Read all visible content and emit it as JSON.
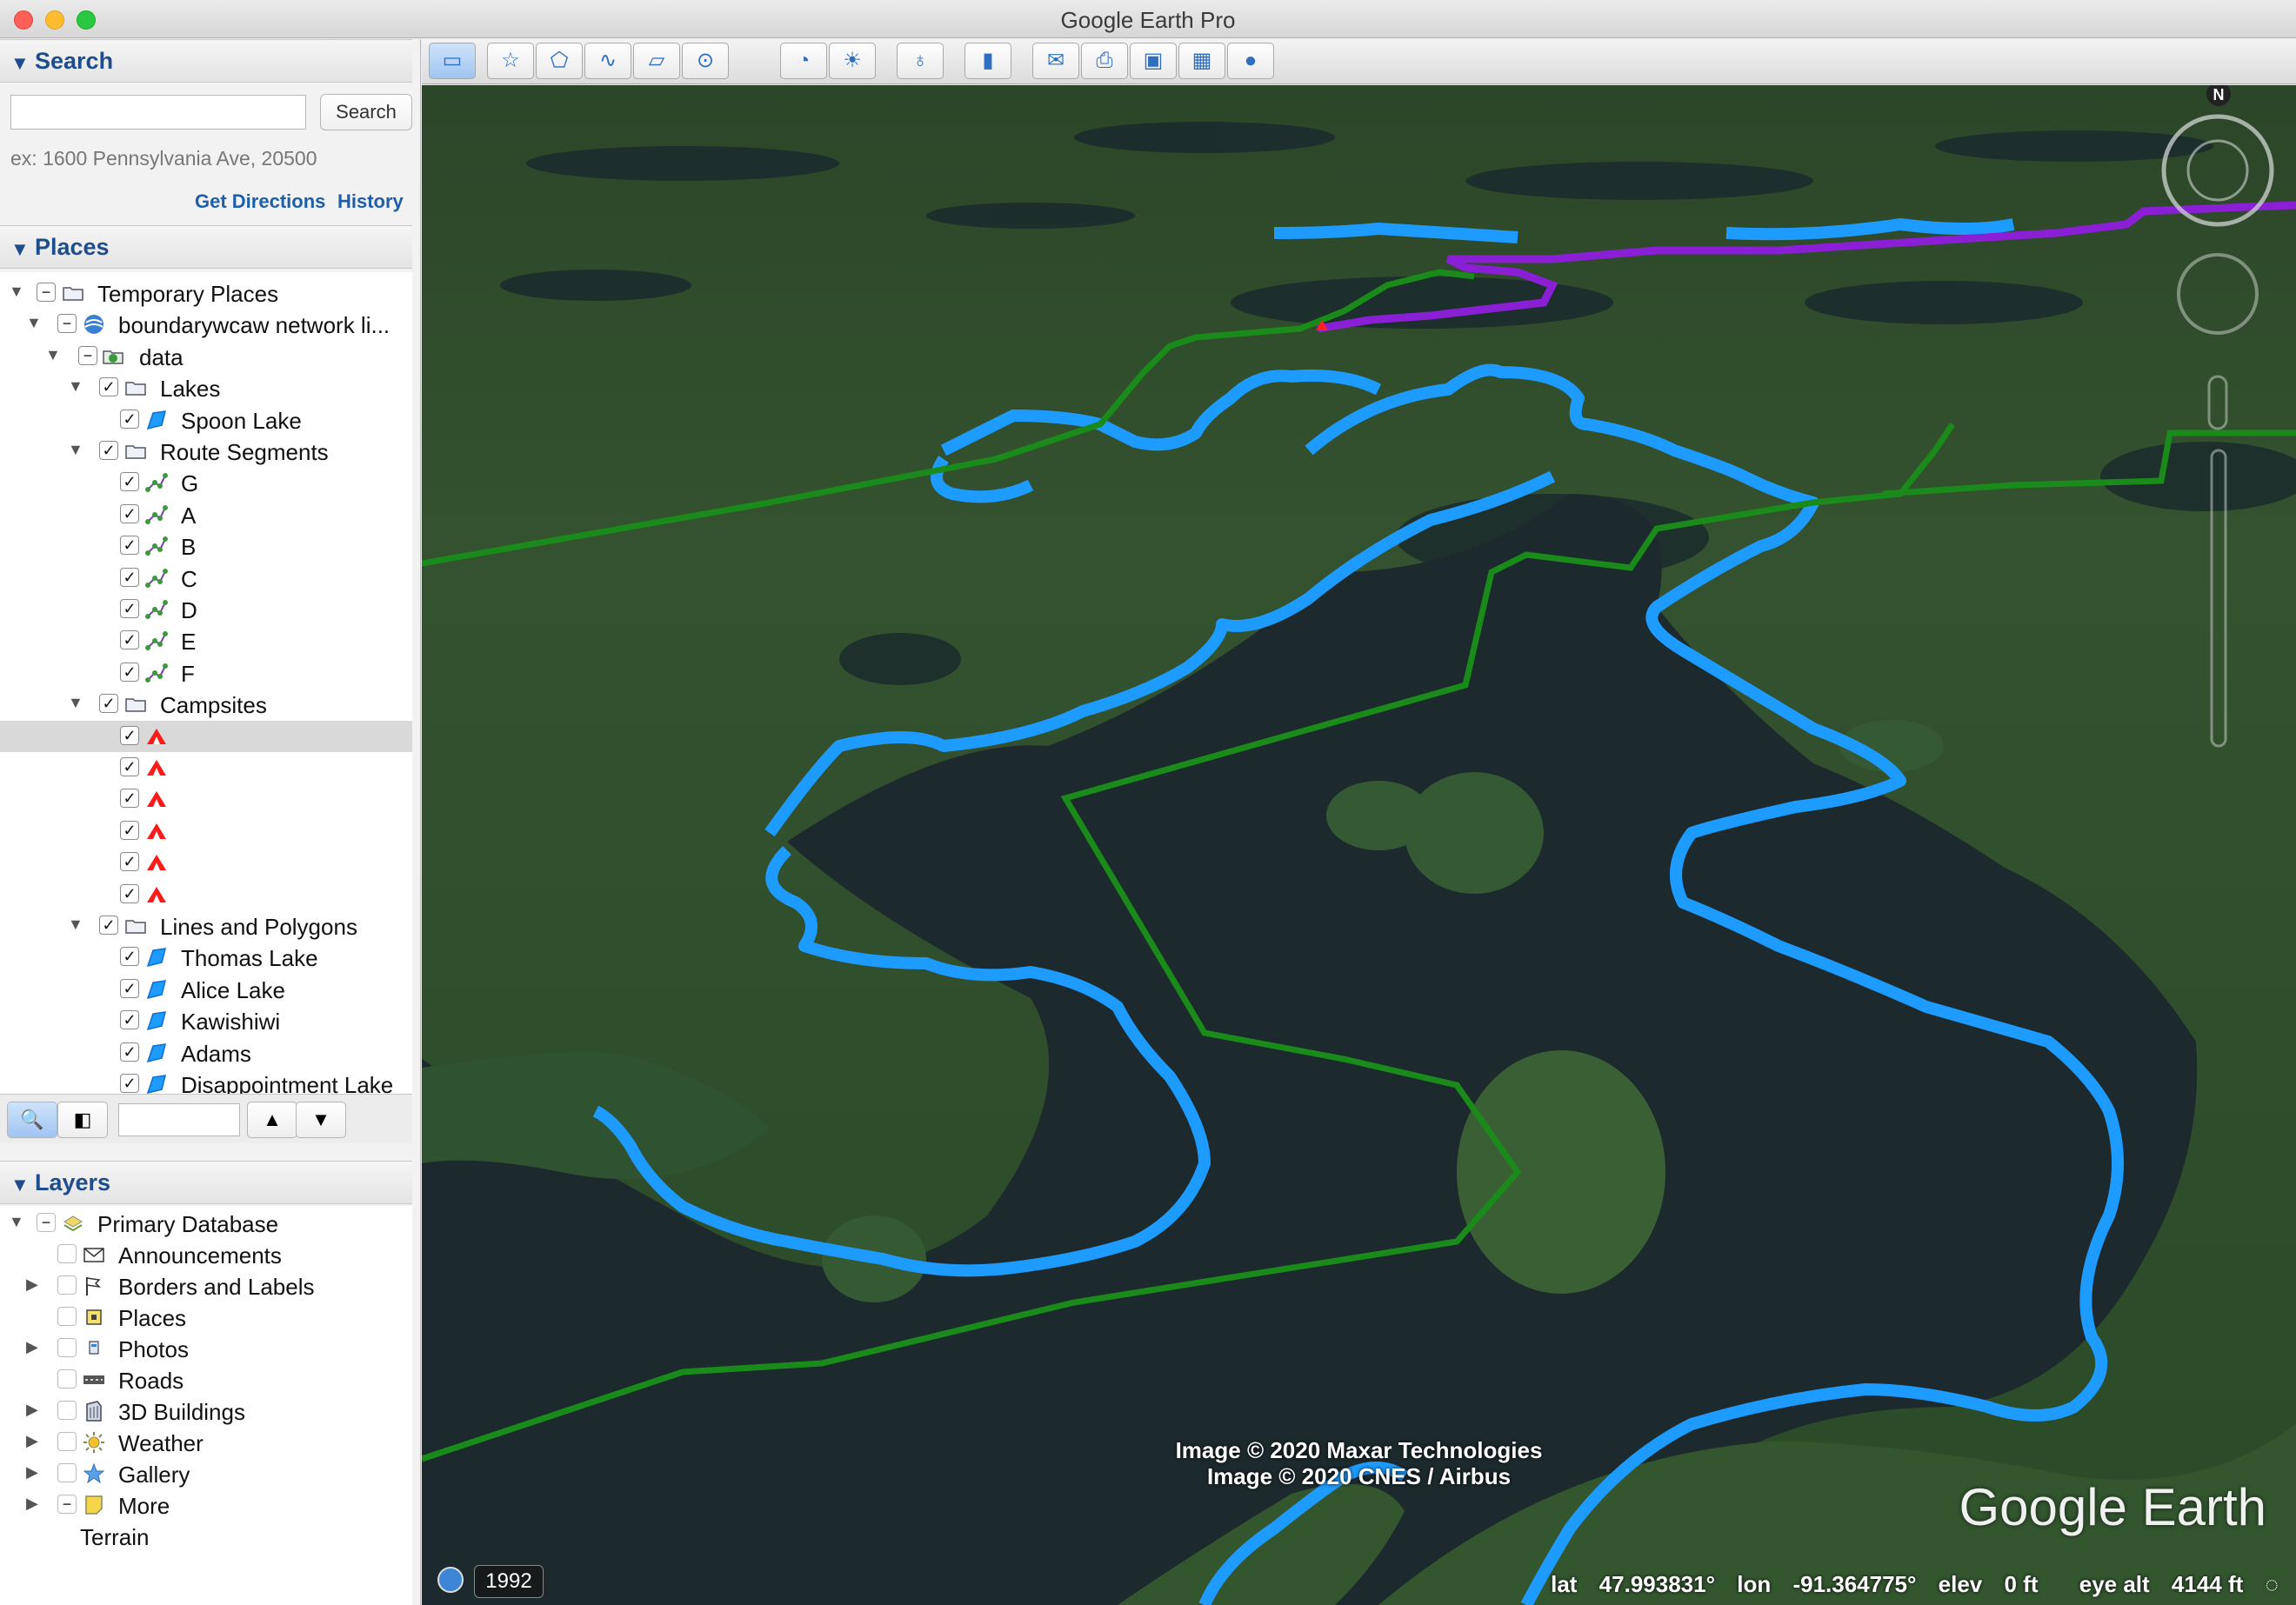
{
  "window": {
    "title": "Google Earth Pro"
  },
  "search": {
    "header": "Search",
    "button": "Search",
    "placeholder": "",
    "hint": "ex: 1600 Pennsylvania Ave, 20500",
    "get_directions": "Get Directions",
    "history": "History"
  },
  "places": {
    "header": "Places",
    "items": [
      {
        "label": "Temporary Places",
        "icon": "folder-icon"
      },
      {
        "label": "boundarywcaw network li...",
        "icon": "network-link-icon"
      },
      {
        "label": "data",
        "icon": "data-folder-icon"
      },
      {
        "label": "Lakes",
        "icon": "folder-icon"
      },
      {
        "label": "Spoon Lake",
        "icon": "polygon-icon"
      },
      {
        "label": "Route Segments",
        "icon": "folder-icon"
      },
      {
        "label": "G",
        "icon": "path-icon"
      },
      {
        "label": "A",
        "icon": "path-icon"
      },
      {
        "label": "B",
        "icon": "path-icon"
      },
      {
        "label": "C",
        "icon": "path-icon"
      },
      {
        "label": "D",
        "icon": "path-icon"
      },
      {
        "label": "E",
        "icon": "path-icon"
      },
      {
        "label": "F",
        "icon": "path-icon"
      },
      {
        "label": "Campsites",
        "icon": "folder-icon"
      },
      {
        "label": "",
        "icon": "campsite-icon"
      },
      {
        "label": "",
        "icon": "campsite-icon"
      },
      {
        "label": "",
        "icon": "campsite-icon"
      },
      {
        "label": "",
        "icon": "campsite-icon"
      },
      {
        "label": "",
        "icon": "campsite-icon"
      },
      {
        "label": "",
        "icon": "campsite-icon"
      },
      {
        "label": "Lines and Polygons",
        "icon": "folder-icon"
      },
      {
        "label": "Thomas Lake",
        "icon": "polygon-icon"
      },
      {
        "label": "Alice Lake",
        "icon": "polygon-icon"
      },
      {
        "label": "Kawishiwi",
        "icon": "polygon-icon"
      },
      {
        "label": "Adams",
        "icon": "polygon-icon"
      },
      {
        "label": "Disappointment Lake",
        "icon": "polygon-icon"
      }
    ]
  },
  "layers": {
    "header": "Layers",
    "items": [
      {
        "label": "Primary Database",
        "icon": "database-icon"
      },
      {
        "label": "Announcements",
        "icon": "envelope-icon"
      },
      {
        "label": "Borders and Labels",
        "icon": "flag-icon"
      },
      {
        "label": "Places",
        "icon": "places-icon"
      },
      {
        "label": "Photos",
        "icon": "photo-icon"
      },
      {
        "label": "Roads",
        "icon": "road-icon"
      },
      {
        "label": "3D Buildings",
        "icon": "building-icon"
      },
      {
        "label": "Weather",
        "icon": "sun-icon"
      },
      {
        "label": "Gallery",
        "icon": "star-icon"
      },
      {
        "label": "More",
        "icon": "note-icon"
      },
      {
        "label": "Terrain",
        "icon": ""
      }
    ]
  },
  "map": {
    "attribution_1": "Image © 2020 Maxar Technologies",
    "attribution_2": "Image © 2020 CNES / Airbus",
    "brand": "Google Earth",
    "compass_north": "N",
    "year": "1992",
    "lat_label": "lat",
    "lat": "47.993831°",
    "lon_label": "lon",
    "lon": "-91.364775°",
    "elev_label": "elev",
    "elev": "0 ft",
    "eye_label": "eye alt",
    "eye_alt": "4144 ft"
  },
  "colors": {
    "lake_outline": "#1e9bff",
    "route_green": "#1a8a1a",
    "route_purple": "#8a1fd6",
    "panel_blue": "#1f4d8c"
  }
}
